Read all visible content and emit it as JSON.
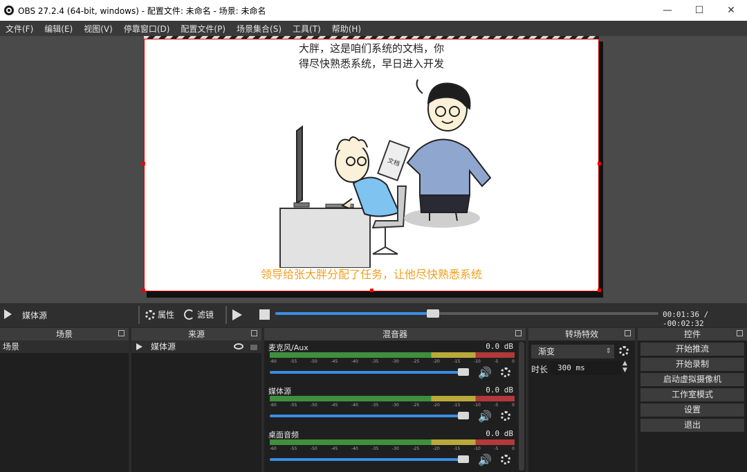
{
  "window": {
    "title": "OBS 27.2.4 (64-bit, windows) - 配置文件: 未命名 - 场景: 未命名",
    "minimize": "—",
    "maximize": "☐",
    "close": "✕"
  },
  "menu": [
    "文件(F)",
    "编辑(E)",
    "视图(V)",
    "停靠窗口(D)",
    "配置文件(P)",
    "场景集合(S)",
    "工具(T)",
    "帮助(H)"
  ],
  "preview": {
    "caption_top_1": "大胖，这是咱们系统的文档，你",
    "caption_top_2": "得尽快熟悉系统，早日进入开发",
    "caption_bottom": "领导给张大胖分配了任务，让他尽快熟悉系统",
    "folder_label": "文档"
  },
  "controls_bar": {
    "source_name": "媒体源",
    "properties_label": "属性",
    "filters_label": "滤镜",
    "time": "00:01:36 / -00:02:32",
    "progress": 0.395
  },
  "docks": {
    "scenes": {
      "title": "场景",
      "items": [
        "场景"
      ]
    },
    "sources": {
      "title": "来源",
      "items": [
        "媒体源"
      ]
    },
    "mixer": {
      "title": "混音器",
      "channels": [
        {
          "name": "麦克风/Aux",
          "db": "0.0 dB",
          "volume": 1.0
        },
        {
          "name": "媒体源",
          "db": "0.0 dB",
          "volume": 1.0
        },
        {
          "name": "桌面音频",
          "db": "0.0 dB",
          "volume": 1.0
        }
      ],
      "ticks": [
        "-60",
        "-55",
        "-50",
        "-45",
        "-40",
        "-35",
        "-30",
        "-25",
        "-20",
        "-15",
        "-10",
        "-5",
        "0"
      ]
    },
    "transitions": {
      "title": "转场特效",
      "selected": "渐变",
      "duration_label": "时长",
      "duration_value": "300 ms"
    },
    "controls": {
      "title": "控件",
      "buttons": [
        "开始推流",
        "开始录制",
        "启动虚拟摄像机",
        "工作室模式",
        "设置",
        "退出"
      ]
    }
  },
  "colors": {
    "accent": "#3a8ee6",
    "caption_orange": "#f0a020",
    "selection_red": "#dd0000"
  }
}
